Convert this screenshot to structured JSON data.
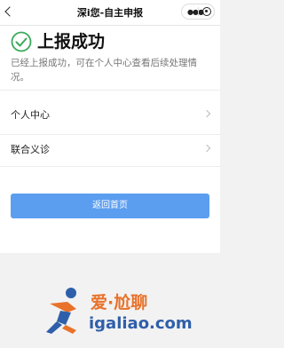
{
  "header": {
    "title": "深i您-自主申报",
    "back_icon": "chevron-left-icon",
    "more_icon": "more-dots-icon",
    "close_icon": "close-circle-icon"
  },
  "result": {
    "title": "上报成功",
    "description": "已经上报成功，可在个人中心查看后续处理情况。",
    "icon": "check-circle-icon",
    "icon_color": "#3aaa5c"
  },
  "menu": {
    "items": [
      {
        "label": "个人中心",
        "icon": "chevron-right-icon"
      },
      {
        "label": "联合义诊",
        "icon": "chevron-right-icon"
      }
    ]
  },
  "actions": {
    "home_label": "返回首页",
    "button_color": "#5b9ef0"
  },
  "watermark": {
    "brand": "爱·尬聊",
    "domain": "igaliao.com",
    "brand_color": "#e8722a",
    "domain_color": "#2f5faa"
  }
}
